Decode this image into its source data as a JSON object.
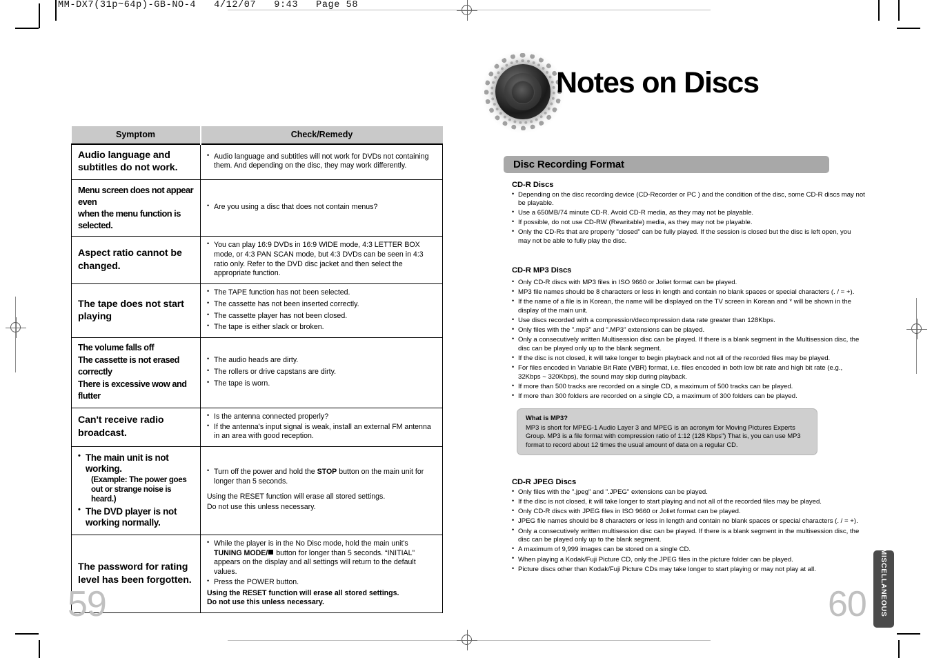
{
  "prepress": {
    "header": "MM-DX7(31p~64p)-GB-NO-4   4/12/07   9:43   Page 58"
  },
  "left_page": {
    "page_number": "59",
    "table": {
      "headers": [
        "Symptom",
        "Check/Remedy"
      ],
      "rows": [
        {
          "symptom_lines": [
            "Audio language and",
            "subtitles do not work."
          ],
          "style": "big",
          "remedies": [
            "Audio language and subtitles will not work for DVDs not containing them. And depending on the disc, they may work differently."
          ]
        },
        {
          "symptom_lines": [
            "Menu screen does not appear even",
            "when the menu function is selected."
          ],
          "style": "condensed",
          "remedies": [
            "Are you using a disc that does not contain menus?"
          ]
        },
        {
          "symptom_lines": [
            "Aspect ratio cannot be",
            "changed."
          ],
          "style": "big",
          "remedies": [
            "You can play 16:9 DVDs in 16:9 WIDE mode, 4:3 LETTER BOX mode, or 4:3 PAN SCAN mode, but 4:3 DVDs can be seen in 4:3 ratio only. Refer to the DVD disc jacket and then select the appropriate function."
          ]
        },
        {
          "symptom_lines": [
            "The tape does not start",
            "playing"
          ],
          "style": "big",
          "remedies": [
            "The TAPE function has not been selected.",
            "The cassette has not been inserted correctly.",
            "The cassette player has not been closed.",
            "The tape is either slack or broken."
          ]
        },
        {
          "symptom_lines": [
            "The volume falls off",
            "The cassette is not erased correctly",
            "There is excessive wow and flutter"
          ],
          "style": "condensed3",
          "remedies": [
            "The audio heads are dirty.",
            "The rollers or drive capstans are dirty.",
            "The tape is worn."
          ]
        },
        {
          "symptom_lines": [
            "Can't receive radio",
            "broadcast."
          ],
          "style": "big",
          "remedies": [
            "Is the antenna connected properly?",
            "If the antenna's input signal is weak, install an external FM antenna in an area with good reception."
          ]
        }
      ],
      "main_unit_row": {
        "symptom_bullets": [
          {
            "text": "The main unit is not working.",
            "sub": "(Example: The power goes out or strange noise is heard.)"
          },
          {
            "text": "The DVD player is not working normally.",
            "sub": ""
          }
        ],
        "remedy_bullet_prefix": "Turn off the power and hold the ",
        "remedy_bullet_bold": "STOP",
        "remedy_bullet_suffix": " button on the main unit for longer than 5 seconds.",
        "remedy_plain_1": "Using the RESET function will erase all stored settings.",
        "remedy_plain_2": "Do not use this unless necessary."
      },
      "password_row": {
        "symptom_lines": [
          "The password for rating",
          "level has been forgotten."
        ],
        "remedy_1_a": "While the player is in the No Disc mode, hold the main unit's ",
        "remedy_1_b": "TUNING MODE/",
        "remedy_1_c": " button for longer than 5 seconds. “INITIAL” appears on the display and all settings will return to the default values.",
        "remedy_2": "Press the POWER button.",
        "remedy_bold_1": "Using the RESET function will erase all stored settings.",
        "remedy_bold_2": "Do not use this unless necessary."
      }
    }
  },
  "right_page": {
    "page_number": "60",
    "title": "Notes on Discs",
    "section_bar": "Disc Recording Format",
    "side_tab": "MISCELLANEOUS",
    "blocks": [
      {
        "heading": "CD-R Discs",
        "items": [
          "Depending on the disc recording device (CD-Recorder or PC ) and the condition of the disc, some CD-R discs may not be playable.",
          "Use a 650MB/74 minute CD-R. Avoid CD-R media, as they may not be playable.",
          "If possible, do not use CD-RW (Rewritable) media, as they may not be playable.",
          "Only the CD-Rs that are properly \"closed\" can be fully played. If the session is closed but the disc is left open, you may not be able to fully play the disc."
        ]
      },
      {
        "heading": "CD-R MP3 Discs",
        "items": [
          "Only CD-R discs with MP3 files in ISO 9660 or Joliet format can be played.",
          "MP3 file names should be 8 characters or less in length and contain no blank spaces or special characters (. / = +).",
          "If the name of a file is in Korean, the name will be displayed on the TV screen in Korean and * will be shown in the display of the main unit.",
          "Use discs recorded with a compression/decompression data rate greater than 128Kbps.",
          "Only files with the \".mp3\" and \".MP3\" extensions can be played.",
          "Only a consecutively written Multisession disc can be played. If there is a blank segment in the Multisession disc, the disc can be played only up to the blank segment.",
          "If the disc is not closed, it will take longer to begin playback and not all of the recorded files may be played.",
          "For files encoded in Variable Bit Rate (VBR) format, i.e. files encoded in both low bit rate and high bit rate (e.g., 32Kbps ~ 320Kbps), the sound may skip during playback.",
          "If more than 500 tracks are recorded on a single CD, a maximum of 500 tracks can be played.",
          "If more than 300 folders are recorded on a single CD, a maximum of 300 folders can be played."
        ]
      },
      {
        "heading": "CD-R JPEG Discs",
        "items": [
          "Only files with the \".jpeg\" and \".JPEG\" extensions can be played.",
          "If the disc is not closed, it will take longer to start playing and not all of the recorded files may be played.",
          "Only CD-R discs with JPEG files in ISO 9660 or Joliet format can be played.",
          "JPEG file names should be 8 characters or less in length and contain no blank spaces or special characters (. / = +).",
          "Only a consecutively written multisession disc can be played. If there is a blank segment in the multisession disc, the disc can be played only up to the blank segment.",
          "A maximum of 9,999 images can be stored on a single CD.",
          "When playing a Kodak/Fuji Picture CD, only the JPEG files in the picture folder can be played.",
          "Picture discs other than Kodak/Fuji Picture CDs may take longer to start playing or may not play at all."
        ]
      }
    ],
    "mp3_note": {
      "title": "What is MP3?",
      "body": "MP3 is short for MPEG-1 Audio Layer 3 and MPEG is an acronym for Moving Pictures Experts Group. MP3 is a file format with compression ratio of 1:12 (128 Kbps\") That is, you can use MP3 format to record about 12 times the usual amount of data on a regular CD."
    }
  }
}
